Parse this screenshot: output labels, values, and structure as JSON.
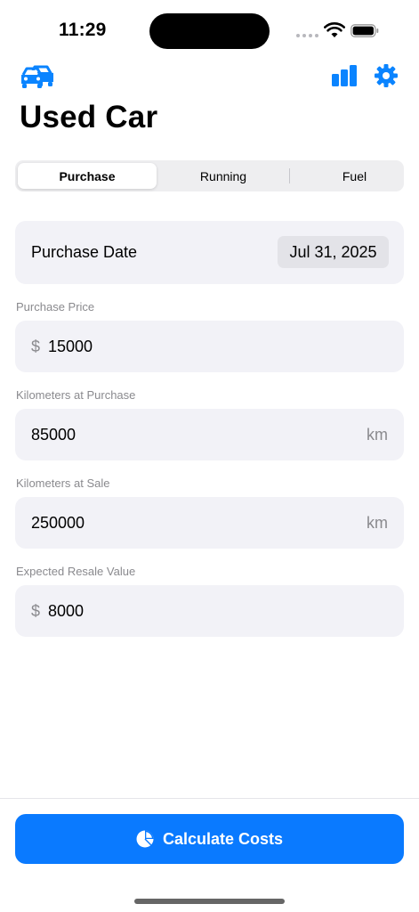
{
  "status_bar": {
    "time": "11:29"
  },
  "nav": {
    "left_icon": "cars-icon",
    "right_icons": [
      "chart-icon",
      "gear-icon"
    ],
    "accent": "#0a84ff"
  },
  "page_title": "Used Car",
  "tabs": [
    {
      "label": "Purchase",
      "selected": true
    },
    {
      "label": "Running",
      "selected": false
    },
    {
      "label": "Fuel",
      "selected": false
    }
  ],
  "purchase_date": {
    "label": "Purchase Date",
    "value": "Jul 31, 2025"
  },
  "fields": {
    "purchase_price": {
      "label": "Purchase Price",
      "prefix": "$",
      "value": "15000"
    },
    "km_purchase": {
      "label": "Kilometers at Purchase",
      "value": "85000",
      "unit": "km"
    },
    "km_sale": {
      "label": "Kilometers at Sale",
      "value": "250000",
      "unit": "km"
    },
    "resale_value": {
      "label": "Expected Resale Value",
      "prefix": "$",
      "value": "8000"
    }
  },
  "calculate_button": {
    "label": "Calculate Costs",
    "icon": "pie-chart-icon",
    "color": "#0a7aff"
  }
}
